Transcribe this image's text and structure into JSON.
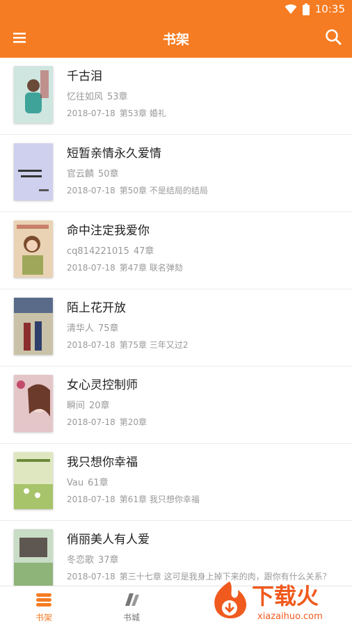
{
  "status_bar": {
    "time": "10:35"
  },
  "header": {
    "title": "书架"
  },
  "books": [
    {
      "title": "千古泪",
      "author": "忆往如风",
      "chapters": "53章",
      "date": "2018-07-18",
      "last_chapter": "第53章 婚礼",
      "cover_color": "#cfe6e0"
    },
    {
      "title": "短暂亲情永久爱情",
      "author": "官云麟",
      "chapters": "50章",
      "date": "2018-07-18",
      "last_chapter": "第50章 不是结局的结局",
      "cover_color": "#cfd0ee"
    },
    {
      "title": "命中注定我爱你",
      "author": "cq814221015",
      "chapters": "47章",
      "date": "2018-07-18",
      "last_chapter": "第47章 联名弹劾",
      "cover_color": "#e9d3b4"
    },
    {
      "title": "陌上花开放",
      "author": "清华人",
      "chapters": "75章",
      "date": "2018-07-18",
      "last_chapter": "第75章 三年又过2",
      "cover_color": "#c9c2a8"
    },
    {
      "title": "女心灵控制师",
      "author": "瞬间",
      "chapters": "20章",
      "date": "2018-07-18",
      "last_chapter": "第20章",
      "cover_color": "#e4c6c9"
    },
    {
      "title": "我只想你幸福",
      "author": "Vau",
      "chapters": "61章",
      "date": "2018-07-18",
      "last_chapter": "第61章 我只想你幸福",
      "cover_color": "#dfe7c1"
    },
    {
      "title": "俏丽美人有人爱",
      "author": "冬恋歌",
      "chapters": "37章",
      "date": "2018-07-18",
      "last_chapter": "第三十七章 这可是我身上掉下来的肉，跟你有什么关系？",
      "cover_color": "#c9dcc6"
    }
  ],
  "bottom_nav": {
    "shelf": "书架",
    "store": "书城"
  },
  "watermark": {
    "brand": "下载火",
    "url": "xiazaihuo.com"
  },
  "colors": {
    "accent": "#f57c22"
  }
}
